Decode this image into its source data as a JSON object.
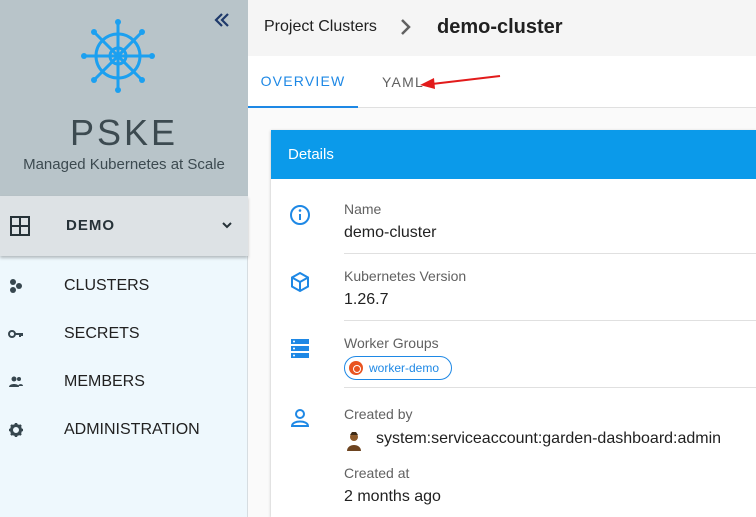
{
  "brand": {
    "title": "PSKE",
    "subtitle": "Managed Kubernetes at Scale"
  },
  "project": {
    "name": "DEMO"
  },
  "sidebar": {
    "items": [
      {
        "label": "CLUSTERS",
        "icon": "clusters-icon"
      },
      {
        "label": "SECRETS",
        "icon": "key-icon"
      },
      {
        "label": "MEMBERS",
        "icon": "members-icon"
      },
      {
        "label": "ADMINISTRATION",
        "icon": "gear-icon"
      }
    ]
  },
  "breadcrumb": {
    "parent": "Project Clusters",
    "current": "demo-cluster"
  },
  "tabs": [
    {
      "label": "OVERVIEW",
      "active": true
    },
    {
      "label": "YAML",
      "active": false
    }
  ],
  "details": {
    "header": "Details",
    "name_label": "Name",
    "name_value": "demo-cluster",
    "k8s_label": "Kubernetes Version",
    "k8s_value": "1.26.7",
    "workers_label": "Worker Groups",
    "worker_chip": "worker-demo",
    "created_by_label": "Created by",
    "created_by_value": "system:serviceaccount:garden-dashboard:admin",
    "created_at_label": "Created at",
    "created_at_value": "2 months ago"
  },
  "colors": {
    "accent": "#1e88e5",
    "card_header": "#0b9aea",
    "annotation_arrow": "#e21b1b"
  }
}
